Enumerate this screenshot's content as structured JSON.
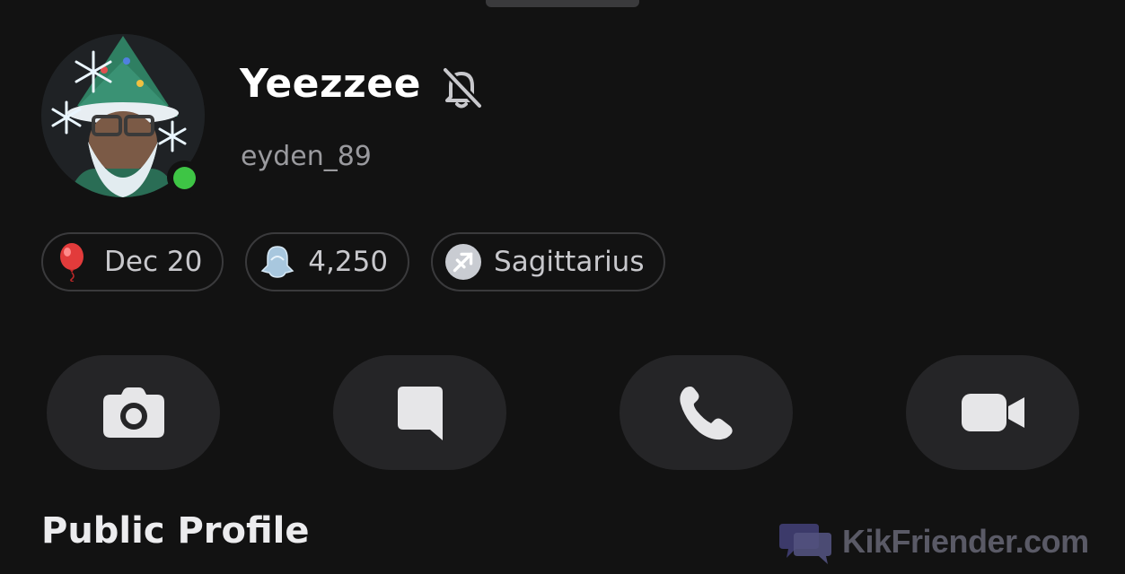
{
  "profile": {
    "display_name": "Yeezzee",
    "username": "eyden_89",
    "online_color": "#3ec545"
  },
  "chips": [
    {
      "icon": "balloon-icon",
      "label": "Dec 20"
    },
    {
      "icon": "ghost-icon",
      "label": "4,250"
    },
    {
      "icon": "sagittarius-icon",
      "label": "Sagittarius"
    }
  ],
  "actions": [
    {
      "icon": "camera-icon"
    },
    {
      "icon": "chat-icon"
    },
    {
      "icon": "phone-icon"
    },
    {
      "icon": "video-icon"
    }
  ],
  "sections": {
    "public_profile_title": "Public Profile"
  },
  "watermark": {
    "text": "KikFriender.com"
  }
}
